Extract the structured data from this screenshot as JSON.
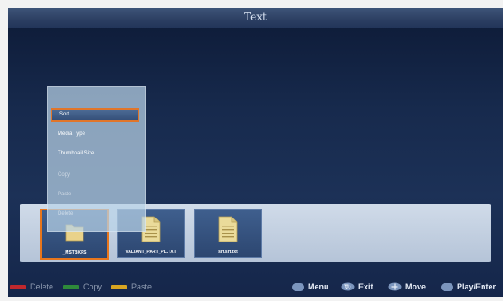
{
  "window": {
    "title": "Text"
  },
  "context_menu": {
    "items": [
      {
        "label": "Sort",
        "state": "highlighted"
      },
      {
        "label": "Media Type",
        "state": "enabled"
      },
      {
        "label": "Thumbnail Size",
        "state": "enabled"
      },
      {
        "label": "Copy",
        "state": "disabled"
      },
      {
        "label": "Paste",
        "state": "disabled"
      },
      {
        "label": "Delete",
        "state": "disabled"
      }
    ]
  },
  "files": [
    {
      "name": "_MSTBKFS",
      "type": "folder",
      "selected": true
    },
    {
      "name": "VALIANT_PART_PL.TXT",
      "type": "text-file",
      "selected": false
    },
    {
      "name": "srt.srt.txt",
      "type": "text-file",
      "selected": false
    }
  ],
  "bottom_bar": {
    "color_keys": [
      {
        "label": "Delete",
        "color": "#c0282d"
      },
      {
        "label": "Copy",
        "color": "#2e8a3a"
      },
      {
        "label": "Paste",
        "color": "#d8a521"
      }
    ],
    "remote_keys": [
      {
        "label": "Menu",
        "icon": "menu-key-icon"
      },
      {
        "label": "Exit",
        "icon": "return-key-icon"
      },
      {
        "label": "Move",
        "icon": "dpad-key-icon"
      },
      {
        "label": "Play/Enter",
        "icon": "ok-key-icon"
      }
    ]
  },
  "colors": {
    "highlight": "#e8761c",
    "background": "#172a4d"
  }
}
